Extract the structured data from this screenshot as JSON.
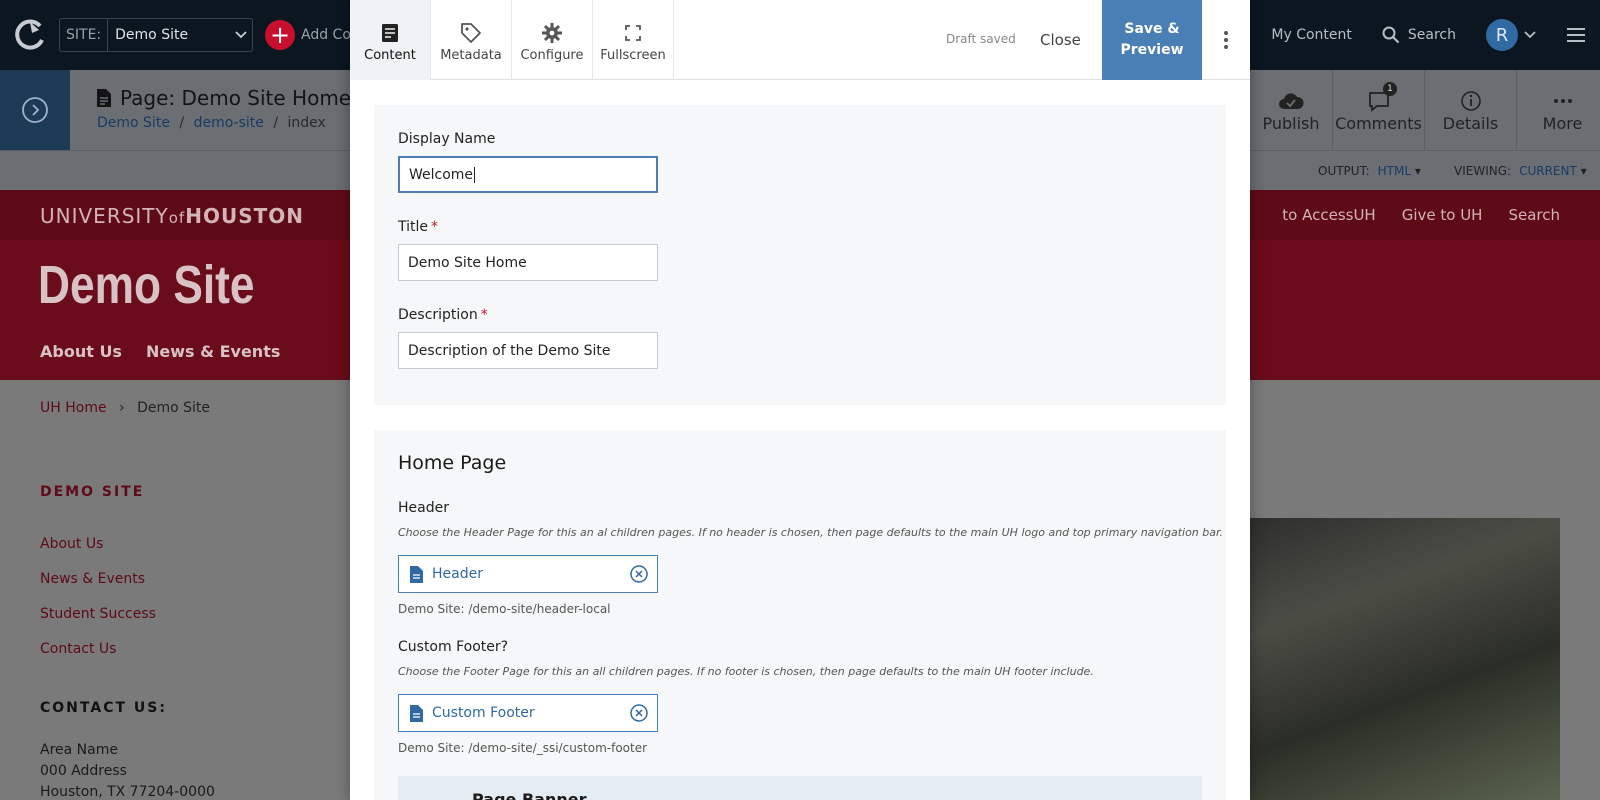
{
  "topbar": {
    "site_label": "SITE:",
    "site_value": "Demo Site",
    "add_content": "Add Co",
    "my_content": "My Content",
    "search": "Search",
    "avatar_initial": "R"
  },
  "secbar": {
    "page_title": "Page: Demo Site Home",
    "breadcrumb": [
      "Demo Site",
      "/",
      "demo-site",
      "/",
      "index"
    ],
    "actions": {
      "publish": "Publish",
      "comments": "Comments",
      "comments_count": "1",
      "details": "Details",
      "more": "More"
    },
    "output_label": "OUTPUT:",
    "output_value": "HTML",
    "viewing_label": "VIEWING:",
    "viewing_value": "CURRENT"
  },
  "site": {
    "logo_thin": "UNIVERSITY",
    "logo_of": "of",
    "logo_bold": "HOUSTON",
    "util": [
      "to AccessUH",
      "Give to UH",
      "Search"
    ],
    "name": "Demo Site",
    "nav": [
      "About Us",
      "News & Events"
    ],
    "crumb_home": "UH Home",
    "crumb_sep": "›",
    "crumb_current": "Demo Site",
    "side_heading": "DEMO SITE",
    "side_links": [
      "About Us",
      "News & Events",
      "Student Success",
      "Contact Us"
    ],
    "contact_heading": "CONTACT US:",
    "contact_lines": [
      "Area Name",
      "000 Address",
      "Houston, TX 77204-0000"
    ]
  },
  "editor": {
    "tabs": [
      "Content",
      "Metadata",
      "Configure",
      "Fullscreen"
    ],
    "draft_status": "Draft saved",
    "close": "Close",
    "save_preview_line1": "Save &",
    "save_preview_line2": "Preview",
    "fields": {
      "display_name_label": "Display Name",
      "display_name_value": "Welcome",
      "title_label": "Title",
      "title_value": "Demo Site Home",
      "description_label": "Description",
      "description_value": "Description of the Demo Site"
    },
    "home_page": {
      "section_title": "Home Page",
      "header_label": "Header",
      "header_hint": "Choose the Header Page for this an al children pages. If no header is chosen, then page defaults to the main UH logo and top primary navigation bar.",
      "header_item": "Header",
      "header_path": "Demo Site: /demo-site/header-local",
      "footer_label": "Custom Footer?",
      "footer_hint": "Choose the Footer Page for this an all children pages. If no footer is chosen, then page defaults to the main UH footer include.",
      "footer_item": "Custom Footer",
      "footer_path": "Demo Site: /demo-site/_ssi/custom-footer",
      "banner_title": "Page Banner"
    }
  },
  "colors": {
    "accent": "#4a7fb5",
    "brand_red": "#c8102e",
    "topbar_bg": "#0c1621"
  }
}
